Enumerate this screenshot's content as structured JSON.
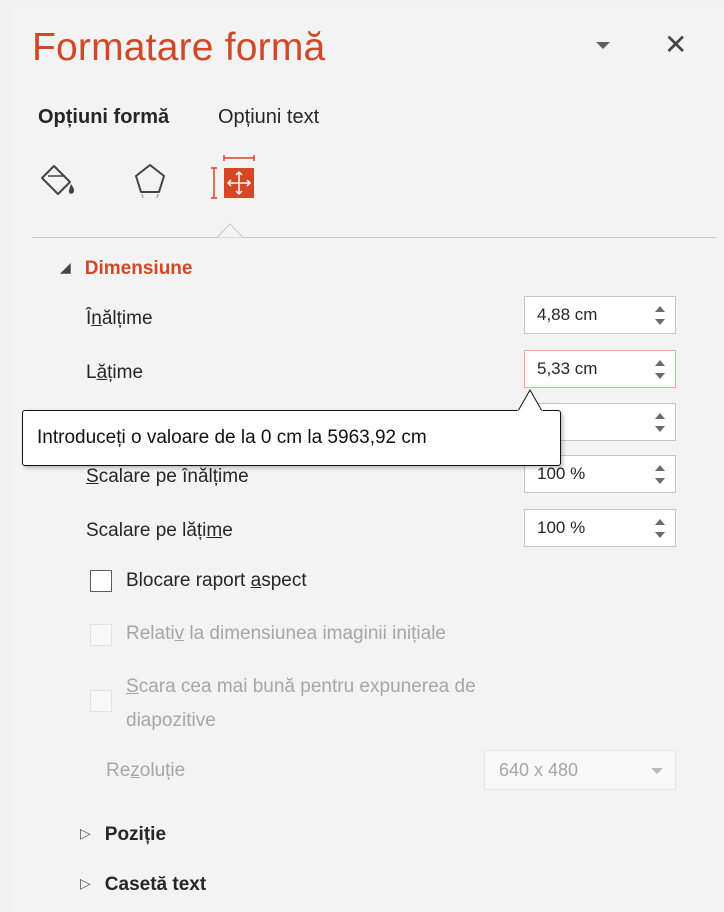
{
  "pane": {
    "title": "Formatare formă",
    "close_glyph": "✕"
  },
  "tabs": [
    {
      "label": "Opțiuni formă",
      "active": true
    },
    {
      "label": "Opțiuni text",
      "active": false
    }
  ],
  "icon_tabs": [
    {
      "icon": "fill-line-icon",
      "selected": false
    },
    {
      "icon": "effects-pentagon-icon",
      "selected": false
    },
    {
      "icon": "size-properties-icon",
      "selected": true
    }
  ],
  "sections": {
    "size": {
      "label": "Dimensiune",
      "expanded": true,
      "height": {
        "label_pre": "Î",
        "label_u": "n",
        "label_post": "ălțime",
        "value": "4,88 cm"
      },
      "width": {
        "label_pre": "L",
        "label_u": "ă",
        "label_post": "țime",
        "value": "5,33 cm"
      },
      "rotation": {
        "value": ""
      },
      "scale_height": {
        "label_pre": "",
        "label_u": "S",
        "label_post": "calare pe înălțime",
        "value": "100 %"
      },
      "scale_width": {
        "label_pre": "Scalare pe lăți",
        "label_u": "m",
        "label_post": "e",
        "value": "100 %"
      },
      "lock_aspect": {
        "label_pre": "Blocare raport ",
        "label_u": "a",
        "label_post": "spect",
        "checked": false,
        "enabled": true
      },
      "relative_original": {
        "label_pre": "Relati",
        "label_u": "v",
        "label_post": " la dimensiunea imaginii inițiale",
        "checked": false,
        "enabled": false
      },
      "best_scale": {
        "label_line1": "Scara cea mai bună pentru expunerea de",
        "label_line1_u": "S",
        "label_line1_rest": "cara cea mai bună pentru expunerea de",
        "label_line2": "diapozitive",
        "checked": false,
        "enabled": false
      },
      "resolution": {
        "label_pre": "Re",
        "label_u": "z",
        "label_post": "oluție",
        "value": "640 x 480",
        "enabled": false
      }
    },
    "position": {
      "label": "Poziție",
      "expanded": false
    },
    "text_box": {
      "label": "Casetă text",
      "expanded": false
    }
  },
  "tooltip": {
    "text": "Introduceți o valoare de la 0 cm la 5963,92 cm"
  },
  "colors": {
    "accent": "#d24726",
    "focus_border": "#f2a78c",
    "pane_bg": "#f3f3f3"
  }
}
